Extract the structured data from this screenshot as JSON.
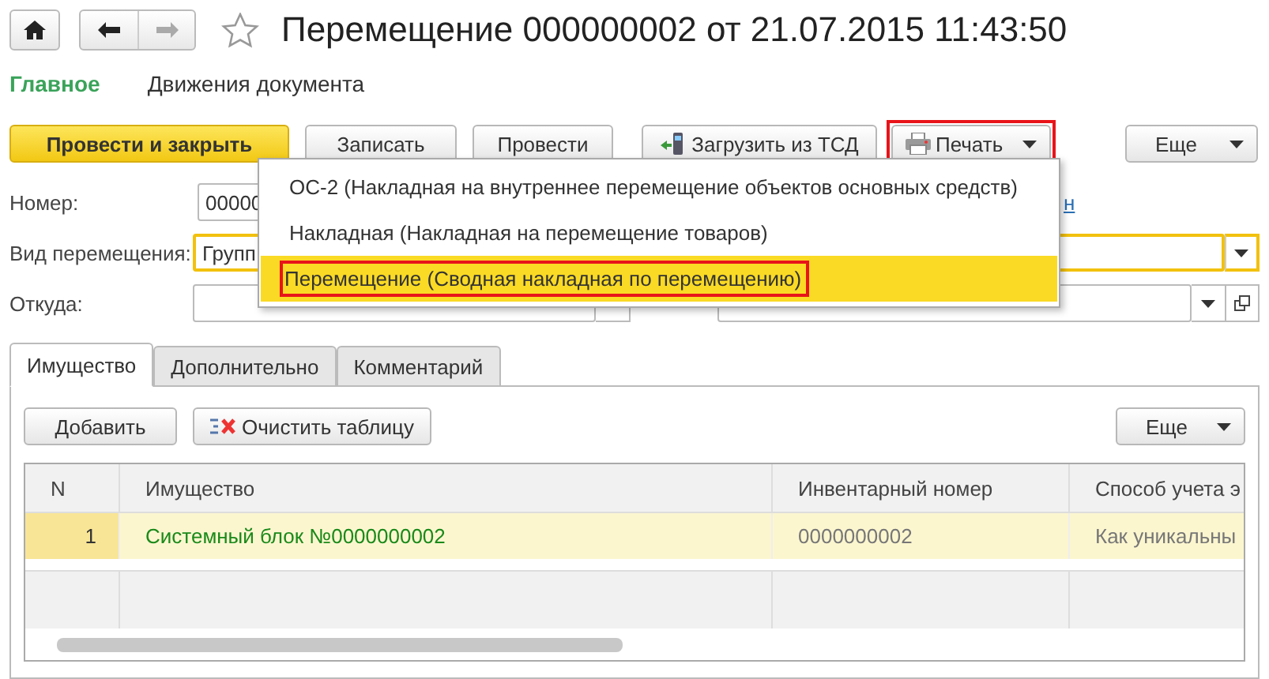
{
  "window": {
    "title": "Перемещение 000000002 от 21.07.2015 11:43:50",
    "favorite": false
  },
  "sections": [
    {
      "label": "Главное",
      "selected": true
    },
    {
      "label": "Движения документа",
      "selected": false
    }
  ],
  "command_bar": {
    "post_close": "Провести и закрыть",
    "buttons": [
      "Записать",
      "Провести"
    ],
    "load": "Загрузить из ТСД",
    "print": "Печать",
    "print_marked": true,
    "more": "Еще"
  },
  "print_menu": [
    {
      "label": "ОС-2 (Накладная на внутреннее перемещение объектов основных средств)",
      "selected": false
    },
    {
      "label": "Накладная (Накладная на перемещение товаров)",
      "selected": false
    },
    {
      "label": "Перемещение (Сводная накладная по перемещению)",
      "selected": true
    }
  ],
  "form": {
    "number_label": "Номер:",
    "number": "00000",
    "link": "н",
    "kind_label": "Вид перемещения:",
    "kind": "Групп",
    "from_label": "Откуда:"
  },
  "tabs": [
    {
      "label": "Имущество",
      "selected": true
    },
    {
      "label": "Дополнительно",
      "selected": false
    },
    {
      "label": "Комментарий",
      "selected": false
    }
  ],
  "table": {
    "add": "Добавить",
    "clear": "Очистить таблицу",
    "more": "Еще",
    "columns": [
      "N",
      "Имущество",
      "Инвентарный номер",
      "Способ учета э"
    ],
    "rows": [
      {
        "cells": [
          "1",
          "Системный блок №0000000002",
          "0000000002",
          "Как уникальны"
        ],
        "selected": true
      }
    ]
  }
}
